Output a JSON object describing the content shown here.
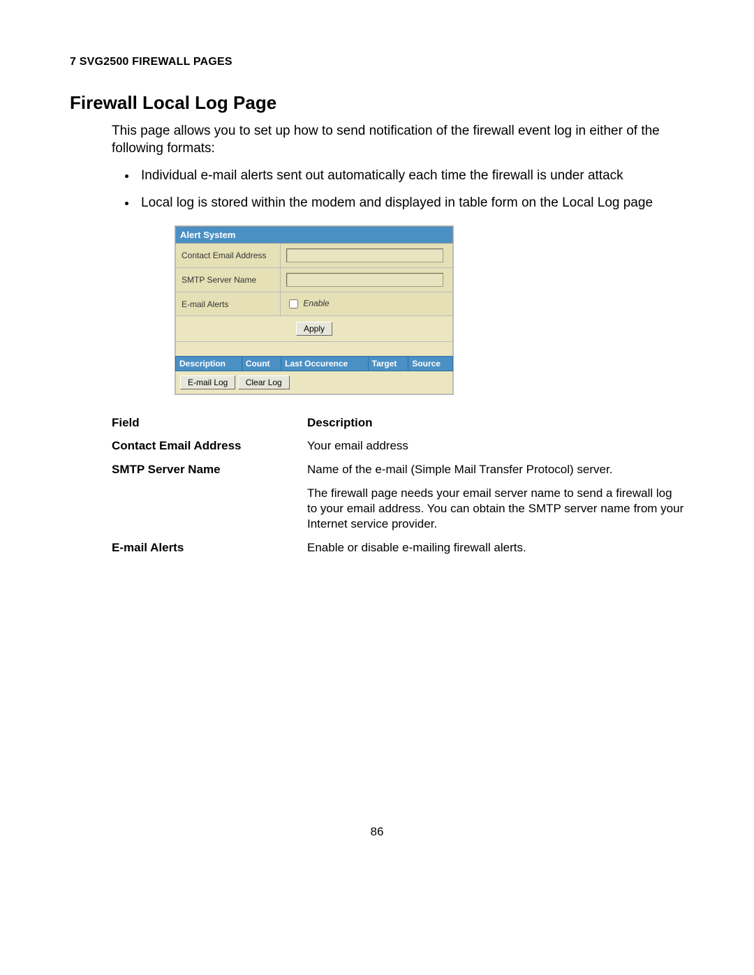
{
  "header": {
    "section": "7 SVG2500 FIREWALL PAGES",
    "title": "Firewall Local Log Page"
  },
  "intro": {
    "para": "This page allows you to set up how to send notification of the firewall event log in either of the following formats:",
    "bullets": [
      "Individual e-mail alerts sent out automatically each time the firewall is under attack",
      "Local log is stored within the modem and displayed in table form on the Local Log page"
    ]
  },
  "ui": {
    "alert_system_header": "Alert System",
    "row_contact_label": "Contact Email Address",
    "row_smtp_label": "SMTP Server Name",
    "row_alerts_label": "E-mail Alerts",
    "enable_label": "Enable",
    "apply_button": "Apply",
    "log_cols": {
      "c1": "Description",
      "c2": "Count",
      "c3": "Last Occurence",
      "c4": "Target",
      "c5": "Source"
    },
    "email_log_button": "E-mail Log",
    "clear_log_button": "Clear Log"
  },
  "field_table": {
    "head_field": "Field",
    "head_desc": "Description",
    "rows": [
      {
        "field": "Contact Email Address",
        "desc": "Your email address"
      },
      {
        "field": "SMTP Server Name",
        "desc": "Name of the e-mail (Simple Mail Transfer Protocol) server."
      },
      {
        "field": "",
        "desc": "The firewall page needs your email server name to send a firewall log to your email address. You can obtain the SMTP server name from your Internet service provider."
      },
      {
        "field": "E-mail Alerts",
        "desc": "Enable or disable e-mailing firewall alerts."
      }
    ]
  },
  "page_number": "86"
}
